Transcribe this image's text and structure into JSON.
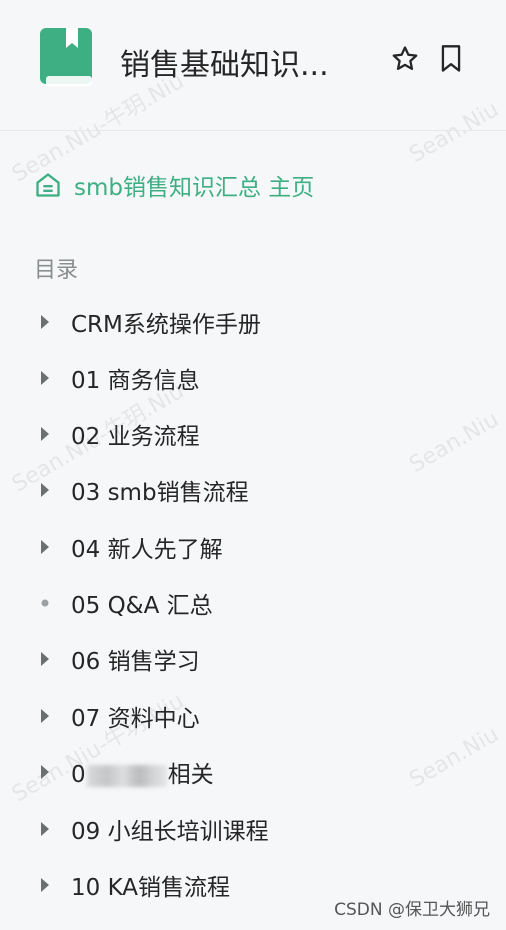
{
  "header": {
    "title": "销售基础知识..."
  },
  "home_link": {
    "label": "smb销售知识汇总 主页"
  },
  "toc": {
    "label": "目录",
    "items": [
      {
        "label": "CRM系统操作手册",
        "marker": "caret"
      },
      {
        "label": "01 商务信息",
        "marker": "caret"
      },
      {
        "label": "02 业务流程",
        "marker": "caret"
      },
      {
        "label": "03 smb销售流程",
        "marker": "caret"
      },
      {
        "label": "04 新人先了解",
        "marker": "caret"
      },
      {
        "label": "05 Q&A 汇总",
        "marker": "dot"
      },
      {
        "label": "06 销售学习",
        "marker": "caret"
      },
      {
        "label": "07 资料中心",
        "marker": "caret"
      },
      {
        "label_prefix": "0",
        "label_suffix": "相关",
        "marker": "caret"
      },
      {
        "label": "09 小组长培训课程",
        "marker": "caret"
      },
      {
        "label": "10 KA销售流程",
        "marker": "caret"
      }
    ]
  },
  "watermark": {
    "text": "Sean.Niu-牛玥.Niu",
    "text_short": "Sean.Niu"
  },
  "footer": {
    "credit": "CSDN @保卫大狮兄"
  },
  "colors": {
    "accent": "#3eaf82",
    "text": "#262626",
    "muted": "#8a8f8d",
    "background": "#f6f7f9"
  },
  "icons": {
    "book": "book-icon",
    "star": "star-icon",
    "bookmark": "bookmark-icon",
    "home": "home-icon",
    "caret": "caret-right-icon",
    "dot": "dot-icon"
  }
}
